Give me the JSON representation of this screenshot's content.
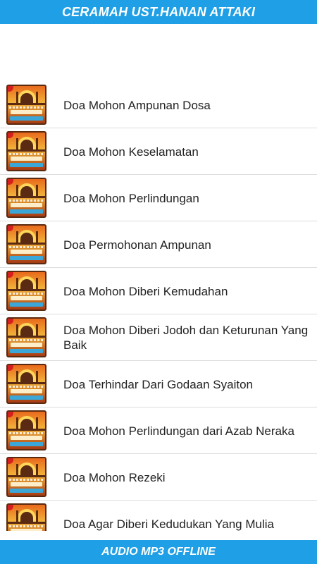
{
  "header": {
    "title": "CERAMAH UST.HANAN ATTAKI"
  },
  "footer": {
    "label": "AUDIO MP3 OFFLINE"
  },
  "list": {
    "thumbnail_icon": "mosque-album-art-icon",
    "items": [
      {
        "title": "Doa Mohon Ampunan Dosa"
      },
      {
        "title": "Doa Mohon Keselamatan"
      },
      {
        "title": "Doa Mohon Perlindungan"
      },
      {
        "title": "Doa Permohonan Ampunan"
      },
      {
        "title": "Doa Mohon Diberi Kemudahan"
      },
      {
        "title": "Doa Mohon Diberi Jodoh dan Keturunan Yang Baik"
      },
      {
        "title": "Doa Terhindar Dari Godaan Syaiton"
      },
      {
        "title": "Doa Mohon Perlindungan dari Azab Neraka"
      },
      {
        "title": "Doa Mohon Rezeki"
      },
      {
        "title": "Doa Agar Diberi Kedudukan Yang Mulia"
      }
    ]
  },
  "colors": {
    "accent": "#1e9fe6",
    "text": "#222222",
    "divider": "#dddddd"
  }
}
